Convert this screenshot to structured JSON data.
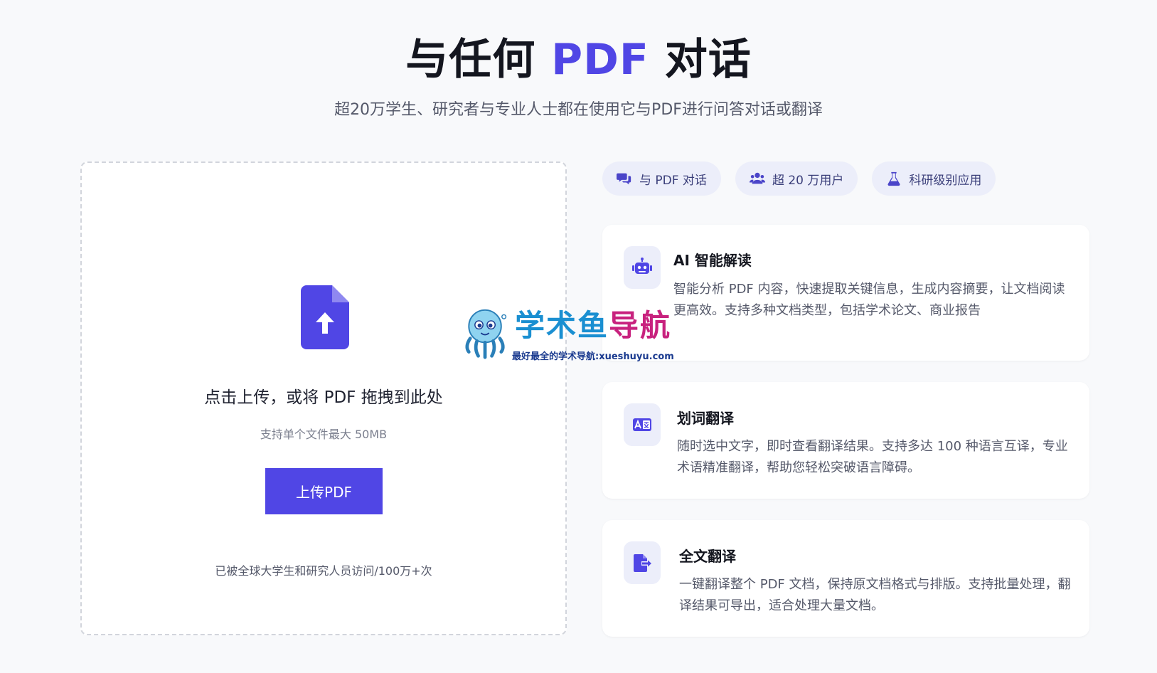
{
  "hero": {
    "title_prefix": "与任何",
    "title_accent": "PDF",
    "title_suffix": "对话",
    "subtitle": "超20万学生、研究者与专业人士都在使用它与PDF进行问答对话或翻译"
  },
  "upload": {
    "icon": "file-upload-icon",
    "drop_text": "点击上传，或将 PDF 拖拽到此处",
    "limit_text": "支持单个文件最大 50MB",
    "button_label": "上传PDF",
    "visits_text": "已被全球大学生和研究人员访问/100万+次"
  },
  "tags": [
    {
      "icon": "chat-bubbles-icon",
      "label": "与 PDF 对话"
    },
    {
      "icon": "users-icon",
      "label": "超 20 万用户"
    },
    {
      "icon": "flask-icon",
      "label": "科研级别应用"
    }
  ],
  "features": [
    {
      "icon": "robot-icon",
      "title": "AI 智能解读",
      "desc": "智能分析 PDF 内容，快速提取关键信息，生成内容摘要，让文档阅读更高效。支持多种文档类型，包括学术论文、商业报告"
    },
    {
      "icon": "translate-icon",
      "title": "划词翻译",
      "desc": "随时选中文字，即时查看翻译结果。支持多达 100 种语言互译，专业术语精准翻译，帮助您轻松突破语言障碍。"
    },
    {
      "icon": "file-export-icon",
      "title": "全文翻译",
      "desc": "一键翻译整个 PDF 文档，保持原文档格式与排版。支持批量处理，翻译结果可导出，适合处理大量文档。"
    }
  ],
  "watermark": {
    "title_a": "学术鱼",
    "title_b": "导航",
    "subtitle": "最好最全的学术导航:xueshuyu.com"
  },
  "colors": {
    "accent": "#5046e5",
    "tag_bg": "#eceefa",
    "page_bg": "#f8f9fb"
  }
}
